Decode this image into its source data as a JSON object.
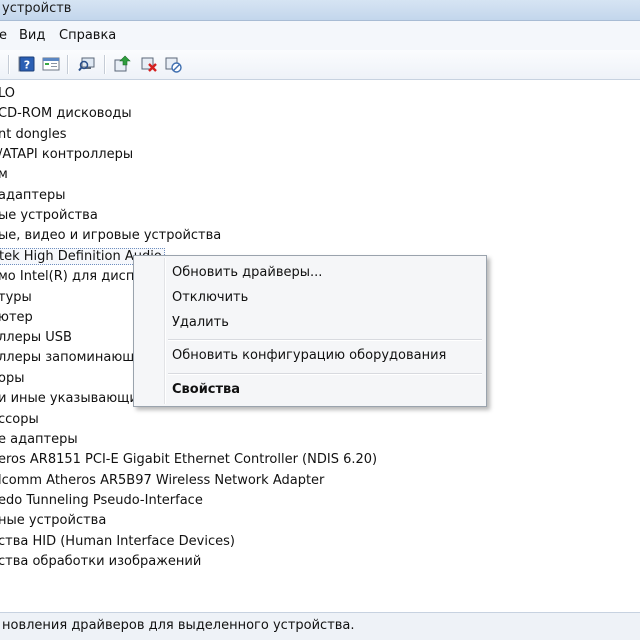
{
  "window": {
    "title": "устройств"
  },
  "menu": {
    "items": [
      {
        "label": "е"
      },
      {
        "label": "Вид"
      },
      {
        "label": "Справка"
      }
    ]
  },
  "toolbar": {
    "icons": [
      "properties-icon",
      "help-icon",
      "view-icon",
      "scan-hardware-icon",
      "update-driver-icon",
      "uninstall-icon",
      "disable-icon"
    ]
  },
  "tree": {
    "items": [
      {
        "label": "LO"
      },
      {
        "label": "CD-ROM дисководы"
      },
      {
        "label": "nt dongles"
      },
      {
        "label": "/ATAPI контроллеры"
      },
      {
        "label": "м"
      },
      {
        "label": "адаптеры"
      },
      {
        "label": "ые устройства"
      },
      {
        "label": "ые, видео и игровые устройства"
      },
      {
        "label": "tek High Definition Audio"
      },
      {
        "label": "мо Intel(R) для диспле"
      },
      {
        "label": "туры"
      },
      {
        "label": "ютер"
      },
      {
        "label": "ллеры USB"
      },
      {
        "label": "ллеры запоминающи"
      },
      {
        "label": "оры"
      },
      {
        "label": "и иные указывающие"
      },
      {
        "label": "ссоры"
      },
      {
        "label": "е адаптеры"
      },
      {
        "label": "eros AR8151 PCI-E Gigabit Ethernet Controller (NDIS 6.20)"
      },
      {
        "label": "lcomm Atheros AR5B97 Wireless Network Adapter"
      },
      {
        "label": "edo Tunneling Pseudo-Interface"
      },
      {
        "label": "ные устройства"
      },
      {
        "label": "ства HID (Human Interface Devices)"
      },
      {
        "label": "ства обработки изображений"
      }
    ]
  },
  "context_menu": {
    "update_driver": "Обновить драйверы...",
    "disable": "Отключить",
    "uninstall": "Удалить",
    "scan_hardware": "Обновить конфигурацию оборудования",
    "properties": "Свойства"
  },
  "status": {
    "text": "новления драйверов для выделенного устройства."
  }
}
